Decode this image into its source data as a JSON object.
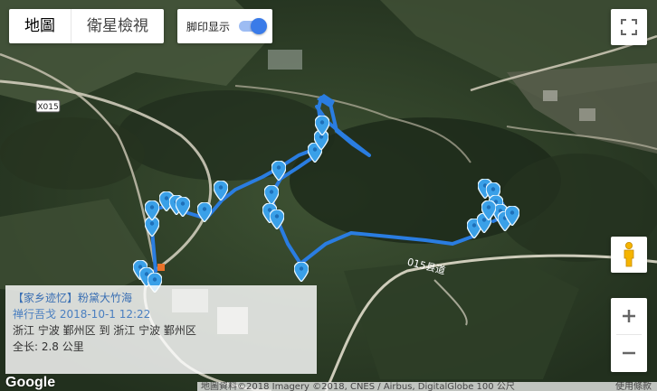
{
  "map_type": {
    "map_label": "地圖",
    "satellite_label": "衛星檢視"
  },
  "track_toggle": {
    "label": "脚印显示",
    "on": true
  },
  "road_labels": {
    "x015": "X015",
    "county_road": "015县道"
  },
  "info_panel": {
    "title": "【家乡迹忆】粉黛大竹海",
    "line2": "禅行吾戈 2018-10-1 12:22",
    "line3": "浙江 宁波 鄞州区 到 浙江 宁波 鄞州区",
    "line4": "全长: 2.8 公里"
  },
  "footer": {
    "logo": "Google",
    "attribution": "地圖資料©2018 Imagery ©2018, CNES / Airbus, DigitalGlobe   100 公尺",
    "terms": "使用條款"
  },
  "colors": {
    "track": "#2a7de1",
    "marker": "#3aa0e8",
    "forest_dark": "#1f2c1c",
    "forest_mid": "#35492d"
  }
}
